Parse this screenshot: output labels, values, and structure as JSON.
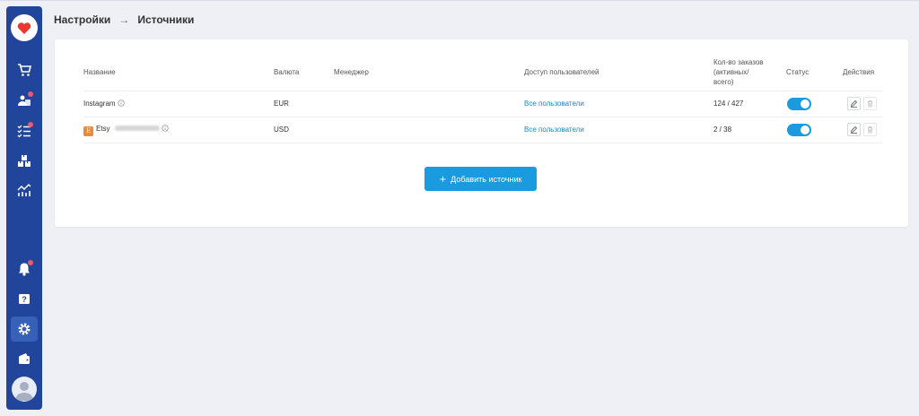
{
  "breadcrumb": {
    "parent": "Настройки",
    "separator": "→",
    "current": "Источники"
  },
  "table": {
    "headers": {
      "name": "Название",
      "currency": "Валюта",
      "manager": "Менеджер",
      "access": "Доступ пользователей",
      "orders_line1": "Кол-во заказов",
      "orders_line2": "(активных/",
      "orders_line3": "всего)",
      "status": "Статус",
      "actions": "Действия"
    },
    "rows": [
      {
        "name": "Instagram",
        "currency": "EUR",
        "manager": "",
        "access": "Все пользователи",
        "orders": "124 / 427",
        "status_on": true
      },
      {
        "name": "Etsy",
        "badge": "E",
        "currency": "USD",
        "manager": "",
        "access": "Все пользователи",
        "orders": "2 / 38",
        "status_on": true
      }
    ]
  },
  "add_button": {
    "label": "Добавить источник",
    "icon": "+"
  },
  "colors": {
    "sidebar": "#21459a",
    "accent": "#1a9be0",
    "link": "#1a88c9",
    "notification": "#f0566d",
    "etsy": "#e98b3a"
  },
  "icons": {
    "sidebar": [
      "heart-logo-icon",
      "cart-icon",
      "customers-icon",
      "tasks-icon",
      "warehouse-icon",
      "analytics-icon",
      "bell-icon",
      "help-icon",
      "settings-icon",
      "wallet-icon",
      "user-avatar-icon"
    ],
    "row_actions": [
      "edit-icon",
      "delete-icon"
    ]
  }
}
